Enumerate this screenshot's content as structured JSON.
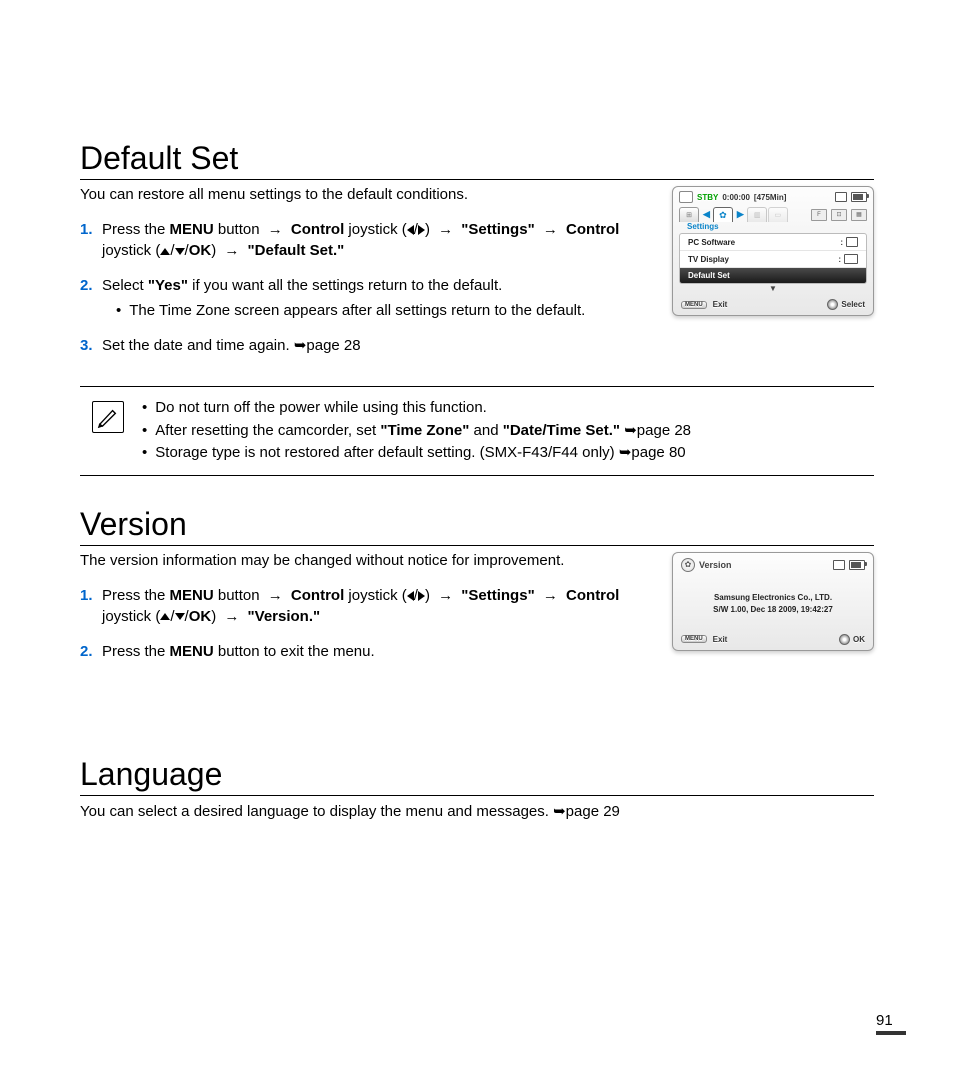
{
  "page_number": "91",
  "sections": {
    "default_set": {
      "heading": "Default Set",
      "desc": "You can restore all menu settings to the default conditions.",
      "step1_num": "1.",
      "step1_a": "Press the ",
      "step1_menu": "MENU",
      "step1_b": " button ",
      "step1_control": "Control",
      "step1_c": " joystick (",
      "step1_d": ") ",
      "step1_settings": "\"Settings\"",
      "step1_e": " ",
      "step1_control2": "Control",
      "step1_f": " joystick (",
      "step1_ok": "OK",
      "step1_g": ") ",
      "step1_target": "\"Default Set.\"",
      "step2_num": "2.",
      "step2_a": "Select ",
      "step2_yes": "\"Yes\"",
      "step2_b": " if you want all the settings return to the default.",
      "step2_bullet": "The Time Zone screen appears after all settings return to the default.",
      "step3_num": "3.",
      "step3_a": "Set the date and time again. ",
      "step3_ref": "page 28",
      "notes": {
        "n1": "Do not turn off the power while using this function.",
        "n2_a": "After resetting the camcorder, set ",
        "n2_tz": "\"Time Zone\"",
        "n2_b": " and ",
        "n2_dt": "\"Date/Time Set.\"",
        "n2_ref": "page 28",
        "n3_a": "Storage type is not restored after default setting. (SMX-F43/F44 only) ",
        "n3_ref": "page 80"
      }
    },
    "version": {
      "heading": "Version",
      "desc": "The version information may be changed without notice for improvement.",
      "step1_num": "1.",
      "step1_a": "Press the ",
      "step1_menu": "MENU",
      "step1_b": " button ",
      "step1_control": "Control",
      "step1_c": " joystick (",
      "step1_d": ") ",
      "step1_settings": "\"Settings\"",
      "step1_e": " ",
      "step1_control2": "Control",
      "step1_f": " joystick (",
      "step1_ok": "OK",
      "step1_g": ") ",
      "step1_target": "\"Version.\"",
      "step2_num": "2.",
      "step2_a": "Press the ",
      "step2_menu": "MENU",
      "step2_b": " button to exit the menu."
    },
    "language": {
      "heading": "Language",
      "desc_a": "You can select a desired language to display the menu and messages. ",
      "desc_ref": "page 29"
    }
  },
  "device1": {
    "stby": "STBY",
    "time": "0:00:00",
    "remain": "[475Min]",
    "settings_label": "Settings",
    "row1": "PC Software",
    "row2": "TV Display",
    "row3": "Default Set",
    "menu_pill": "MENU",
    "exit": "Exit",
    "select": "Select"
  },
  "device2": {
    "title": "Version",
    "line1": "Samsung Electronics Co., LTD.",
    "line2": "S/W 1.00, Dec 18 2009, 19:42:27",
    "menu_pill": "MENU",
    "exit": "Exit",
    "ok": "OK"
  }
}
